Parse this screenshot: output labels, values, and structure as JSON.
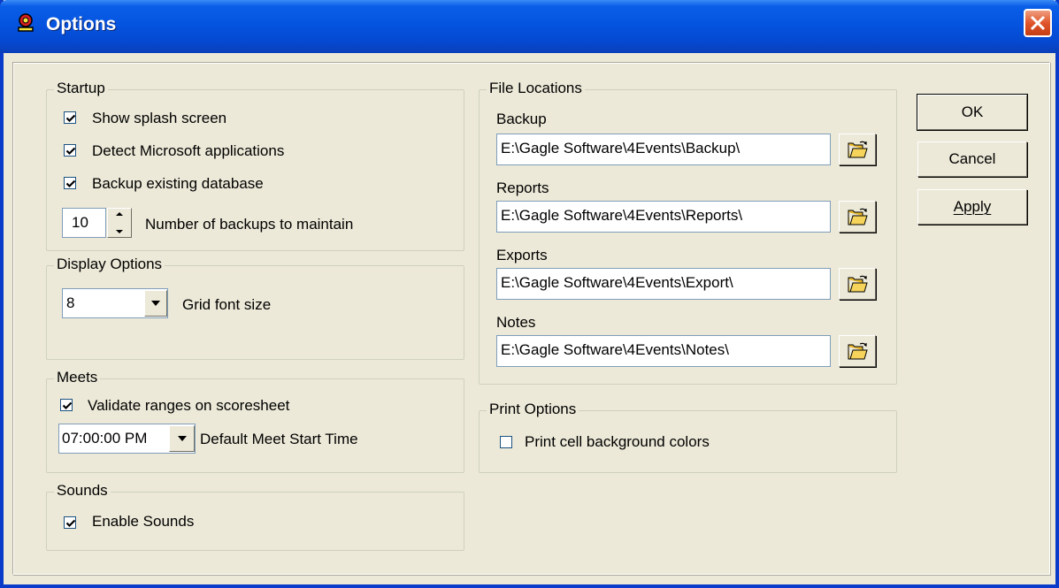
{
  "window": {
    "title": "Options",
    "icon": "app-icon",
    "close_icon": "close-icon"
  },
  "startup": {
    "legend": "Startup",
    "show_splash": {
      "label": "Show splash screen",
      "checked": true
    },
    "detect_ms": {
      "label": "Detect Microsoft applications",
      "checked": true
    },
    "backup_db": {
      "label": "Backup existing database",
      "checked": true
    },
    "num_backups": {
      "value": "10",
      "label": "Number of backups to maintain"
    }
  },
  "display": {
    "legend": "Display Options",
    "grid_font_size": {
      "value": "8",
      "label": "Grid font size"
    }
  },
  "meets": {
    "legend": "Meets",
    "validate": {
      "label": "Validate ranges on scoresheet",
      "checked": true
    },
    "start_time": {
      "value": "07:00:00 PM",
      "label": "Default Meet Start Time"
    }
  },
  "sounds": {
    "legend": "Sounds",
    "enable": {
      "label": "Enable Sounds",
      "checked": true
    }
  },
  "file_locations": {
    "legend": "File Locations",
    "backup": {
      "label": "Backup",
      "value": "E:\\Gagle Software\\4Events\\Backup\\"
    },
    "reports": {
      "label": "Reports",
      "value": "E:\\Gagle Software\\4Events\\Reports\\"
    },
    "exports": {
      "label": "Exports",
      "value": "E:\\Gagle Software\\4Events\\Export\\"
    },
    "notes": {
      "label": "Notes",
      "value": "E:\\Gagle Software\\4Events\\Notes\\"
    }
  },
  "print_options": {
    "legend": "Print Options",
    "print_bg": {
      "label": "Print cell background colors",
      "checked": false
    }
  },
  "buttons": {
    "ok": "OK",
    "cancel": "Cancel",
    "apply": "Apply"
  }
}
